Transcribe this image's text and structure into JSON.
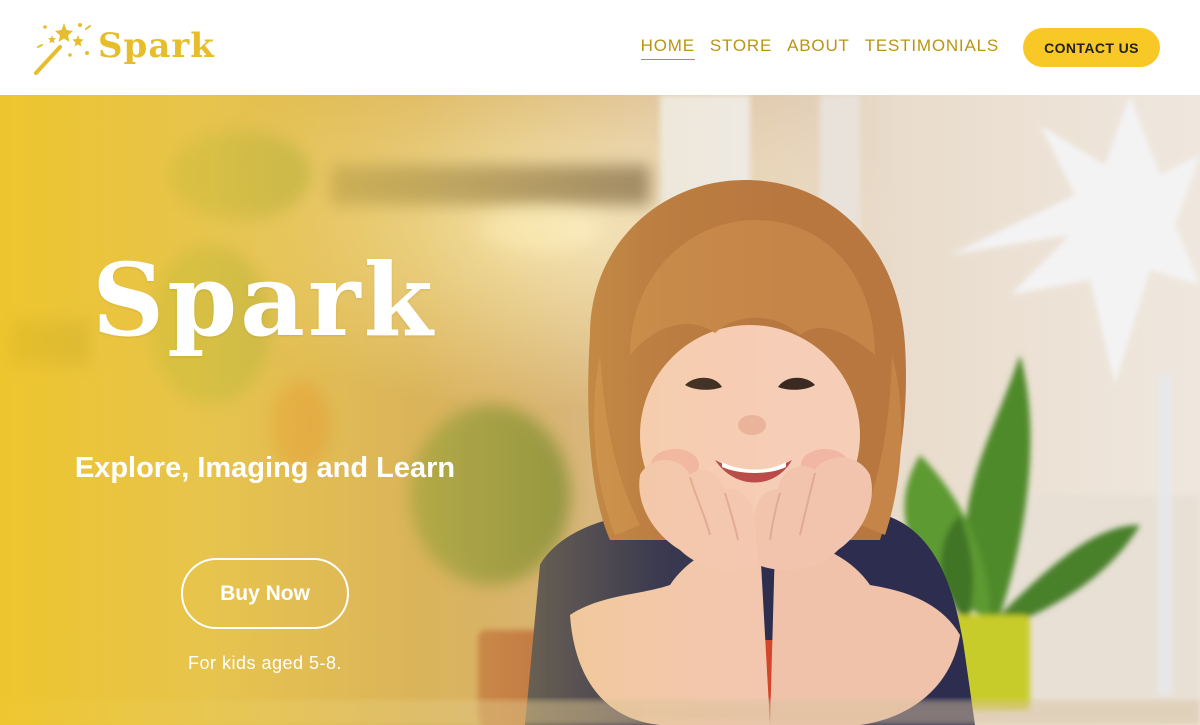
{
  "brand": {
    "name": "Spark",
    "icon": "magic-wand-icon",
    "color": "#e6bd2b"
  },
  "nav": {
    "items": [
      {
        "label": "HOME",
        "active": true
      },
      {
        "label": "STORE",
        "active": false
      },
      {
        "label": "ABOUT",
        "active": false
      },
      {
        "label": "TESTIMONIALS",
        "active": false
      }
    ],
    "link_color": "#b99512",
    "contact_label": "CONTACT US",
    "contact_color": "#f8c926"
  },
  "hero": {
    "title": "Spark",
    "subtitle": "Explore, Imaging and Learn",
    "cta_label": "Buy Now",
    "note": "For kids aged 5-8.",
    "overlay_color": "#f0c828"
  }
}
